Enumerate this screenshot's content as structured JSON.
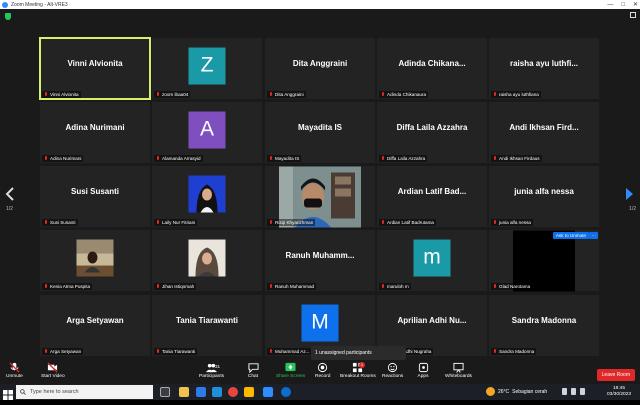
{
  "window": {
    "title": "Zoom Meeting - Alt-VRE3"
  },
  "page_indicator_left": "1/2",
  "page_indicator_right": "1/2",
  "participants": [
    {
      "display": "Vinni Alvionita",
      "label": "Vinni Alvionita",
      "kind": "name",
      "active": true
    },
    {
      "display": "Z",
      "label": "zoom ibaa04",
      "kind": "avatar",
      "color": "#1a9aa6"
    },
    {
      "display": "Dita Anggraini",
      "label": "Dita Anggraini",
      "kind": "name"
    },
    {
      "display": "Adinda Chikana...",
      "label": "Adinda Chikanaura",
      "kind": "name"
    },
    {
      "display": "raisha ayu luthfi...",
      "label": "raisha ayu luthfiana",
      "kind": "name"
    },
    {
      "display": "Adina Nurimani",
      "label": "Adina Nurimani",
      "kind": "name"
    },
    {
      "display": "A",
      "label": "Alamanda Arrasyid",
      "kind": "avatar",
      "color": "#7f4fc0"
    },
    {
      "display": "Mayadita IS",
      "label": "Mayadita IS",
      "kind": "name"
    },
    {
      "display": "Diffa Laila Azzahra",
      "label": "Diffa Laila Azzahra",
      "kind": "name"
    },
    {
      "display": "Andi Ikhsan Fird...",
      "label": "Andi Ikhsan Firdaus",
      "kind": "name"
    },
    {
      "display": "Susi Susanti",
      "label": "Susi Susanti",
      "kind": "name"
    },
    {
      "display": "",
      "label": "Laily Nur Fitriani",
      "kind": "photo-hijab-blue"
    },
    {
      "display": "",
      "label": "Rizqi Khyarizhman",
      "kind": "video"
    },
    {
      "display": "Ardian Latif Bad...",
      "label": "Ardian Latif Badrutama",
      "kind": "name"
    },
    {
      "display": "junia alfa nessa",
      "label": "junia alfa nessa",
      "kind": "name"
    },
    {
      "display": "",
      "label": "Kenia Atma Puspita",
      "kind": "photo-room"
    },
    {
      "display": "",
      "label": "Jihan Istiqomah",
      "kind": "photo-hijab-cream"
    },
    {
      "display": "Ranuh Muhamm...",
      "label": "Ranuh Muhammad",
      "kind": "name"
    },
    {
      "display": "m",
      "label": "maruloh m",
      "kind": "avatar",
      "color": "#1a9aa6"
    },
    {
      "display": "",
      "label": "Glad Narotama",
      "kind": "black",
      "ask_unmute": "Ask to Unmute",
      "more": "···"
    },
    {
      "display": "Arga Setyawan",
      "label": "Arga Setyawan",
      "kind": "name"
    },
    {
      "display": "Tania Tiarawanti",
      "label": "Tania Tiarawanti",
      "kind": "name"
    },
    {
      "display": "M",
      "label": "Muhammad Az...",
      "kind": "avatar",
      "color": "#0e71eb"
    },
    {
      "display": "Aprilian Adhi Nu...",
      "label": "Aprilian Adhi Nugraha",
      "kind": "name"
    },
    {
      "display": "Sandra Madonna",
      "label": "Sandra Madonna",
      "kind": "name"
    }
  ],
  "unassigned_popup": "1 unassigned participants",
  "toolbar": {
    "unmute": "Unmute",
    "start_video": "Start Video",
    "participants": "Participants",
    "participants_count": "31",
    "chat": "Chat",
    "share_screen": "Share Screen",
    "record": "Record",
    "breakout_rooms": "Breakout Rooms",
    "breakout_badge": "1",
    "reactions": "Reactions",
    "apps": "Apps",
    "whiteboards": "Whiteboards",
    "leave": "Leave Room"
  },
  "taskbar": {
    "search_placeholder": "Type here to search",
    "weather_temp": "26°C",
    "weather_desc": "Sebagian cerah",
    "time": "18:45",
    "date": "03/30/2023"
  },
  "colors": {
    "active_outline": "#d7ee6e",
    "share_green": "#2ac25a",
    "leave_red": "#e02828",
    "zoom_blue": "#0e71eb"
  }
}
